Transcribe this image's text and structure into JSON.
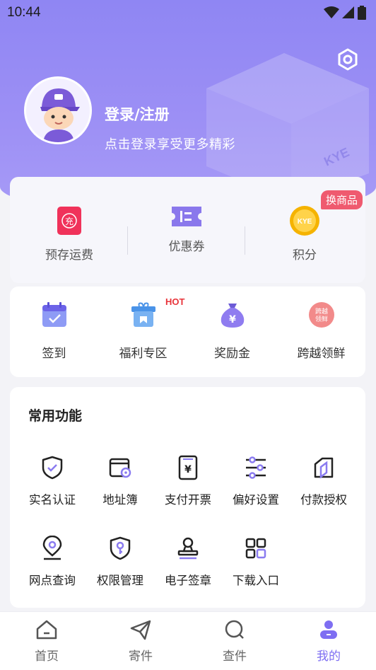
{
  "status_bar": {
    "time": "10:44"
  },
  "colors": {
    "accent": "#7e6ef2",
    "header": "#9a8ff5",
    "badge": "#ef5a6f",
    "hot": "#e8343a"
  },
  "profile": {
    "title": "登录/注册",
    "subtitle": "点击登录享受更多精彩",
    "avatar_icon": "mascot-avatar",
    "settings_icon": "hexagon-settings-icon",
    "box_logo": "KYE"
  },
  "wallet": {
    "badge": "换商品",
    "items": [
      {
        "label": "预存运费",
        "icon": "prepaid-icon",
        "glyph": "充"
      },
      {
        "label": "优惠券",
        "icon": "coupon-icon"
      },
      {
        "label": "积分",
        "icon": "points-coin-icon",
        "glyph": "KYE"
      }
    ]
  },
  "quick": {
    "hot_label": "HOT",
    "items": [
      {
        "label": "签到",
        "icon": "calendar-check-icon"
      },
      {
        "label": "福利专区",
        "icon": "gift-box-icon"
      },
      {
        "label": "奖励金",
        "icon": "money-bag-icon",
        "glyph": "¥"
      },
      {
        "label": "跨越领鲜",
        "icon": "fresh-badge-icon",
        "glyph1": "跨越",
        "glyph2": "领鲜"
      }
    ]
  },
  "functions": {
    "title": "常用功能",
    "items": [
      {
        "label": "实名认证",
        "icon": "shield-check-icon"
      },
      {
        "label": "地址簿",
        "icon": "address-book-icon"
      },
      {
        "label": "支付开票",
        "icon": "invoice-icon",
        "glyph": "¥"
      },
      {
        "label": "偏好设置",
        "icon": "sliders-icon"
      },
      {
        "label": "付款授权",
        "icon": "authorization-icon"
      },
      {
        "label": "网点查询",
        "icon": "location-pin-icon"
      },
      {
        "label": "权限管理",
        "icon": "shield-key-icon"
      },
      {
        "label": "电子签章",
        "icon": "stamp-icon"
      },
      {
        "label": "下载入口",
        "icon": "grid-icon"
      }
    ]
  },
  "tabbar": {
    "items": [
      {
        "label": "首页",
        "icon": "home-icon"
      },
      {
        "label": "寄件",
        "icon": "paper-plane-icon"
      },
      {
        "label": "查件",
        "icon": "search-icon"
      },
      {
        "label": "我的",
        "icon": "user-icon",
        "active": true
      }
    ]
  }
}
